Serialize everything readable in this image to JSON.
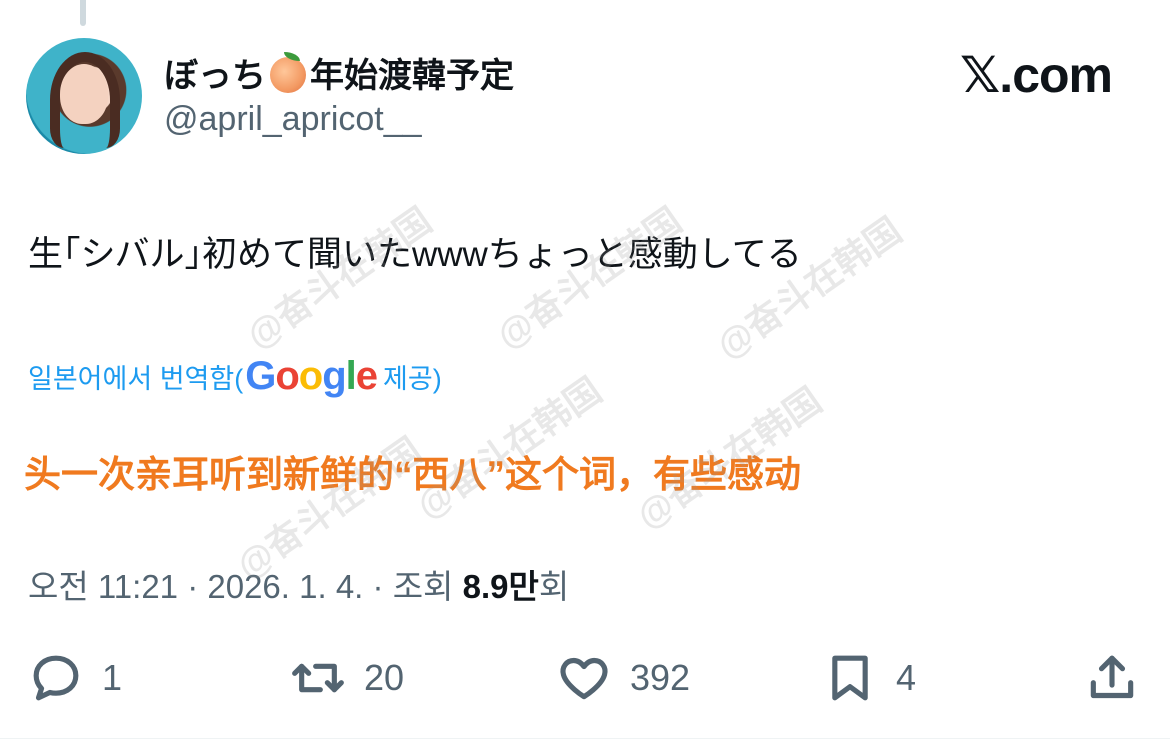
{
  "tweet": {
    "display_name": "ぼっち",
    "display_name_suffix": "年始渡韓予定",
    "handle": "@april_apricot__",
    "brand": "𝕏.com",
    "text": "生｢シバル｣初めて聞いたwwwちょっと感動してる",
    "translation_note_prefix": "일본어에서 번역함(",
    "translation_provider_letters": [
      "G",
      "o",
      "o",
      "g",
      "l",
      "e"
    ],
    "translation_note_suffix": " 제공)",
    "translated_text": "头一次亲耳听到新鲜的“西八”这个词，有些感动",
    "time": "오전 11:21",
    "separator": "·",
    "date": "2026. 1. 4.",
    "views_label": "조회",
    "views_count": "8.9만",
    "views_suffix": "회"
  },
  "actions": {
    "reply_count": "1",
    "retweet_count": "20",
    "like_count": "392",
    "bookmark_count": "4"
  },
  "watermark_text": "@奋斗在韩国",
  "icons": [
    "reply-icon",
    "retweet-icon",
    "like-icon",
    "bookmark-icon",
    "share-icon",
    "peach-emoji-icon"
  ],
  "colors": {
    "accent": "#1d9bf0",
    "translated": "#f07a1f",
    "muted": "#536471"
  }
}
